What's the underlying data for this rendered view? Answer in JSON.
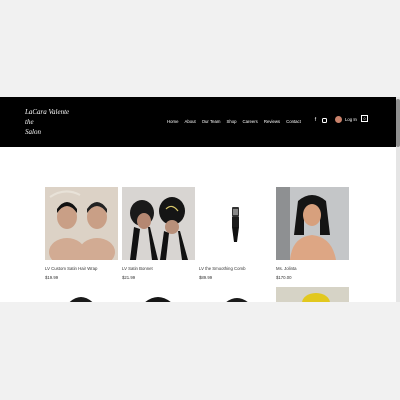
{
  "header": {
    "logo_lines": [
      "LaCara Valente",
      "the",
      "Salon"
    ],
    "nav": [
      "Home",
      "About",
      "Our Team",
      "Shop",
      "Careers",
      "Reviews",
      "Contact"
    ],
    "social_icons": [
      "facebook-icon",
      "instagram-icon"
    ],
    "login_label": "Log In",
    "cart_count": "0"
  },
  "products": [
    {
      "name": "LV Custom Satin Hair Wrap",
      "price": "$19.99"
    },
    {
      "name": "LV Satin Bonnet",
      "price": "$21.99"
    },
    {
      "name": "LV the Smoothing Comb",
      "price": "$89.99"
    },
    {
      "name": "Ms. Jolinta",
      "price": "$170.00"
    }
  ],
  "colors": {
    "header_bg": "#000000",
    "page_bg": "#ffffff",
    "outer_bg": "#f1f1f1"
  }
}
